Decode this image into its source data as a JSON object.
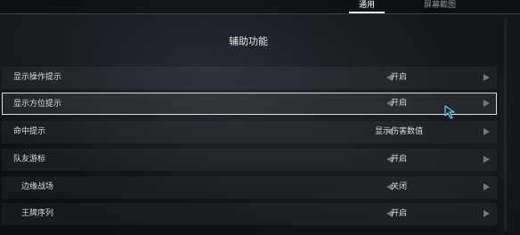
{
  "tabs": [
    {
      "label": "通用",
      "active": true
    },
    {
      "label": "屏幕截图",
      "active": false
    }
  ],
  "section": {
    "title": "辅助功能"
  },
  "rows": [
    {
      "label": "显示操作提示",
      "value": "开启"
    },
    {
      "label": "显示方位提示",
      "value": "开启",
      "selected": true
    },
    {
      "label": "命中提示",
      "value": "显示伤害数值"
    },
    {
      "label": "队友游标",
      "value": "开启"
    },
    {
      "label": "边缘战场",
      "value": "关闭"
    },
    {
      "label": "王牌序列",
      "value": "开启"
    }
  ],
  "icons": {
    "prev": "left-arrow-icon",
    "next": "right-arrow-icon",
    "cursor": "mouse-cursor-icon"
  },
  "colors": {
    "selected_border": "#d8dde4",
    "arrow": "#6f7682",
    "cursor": "#5fd0e6"
  }
}
